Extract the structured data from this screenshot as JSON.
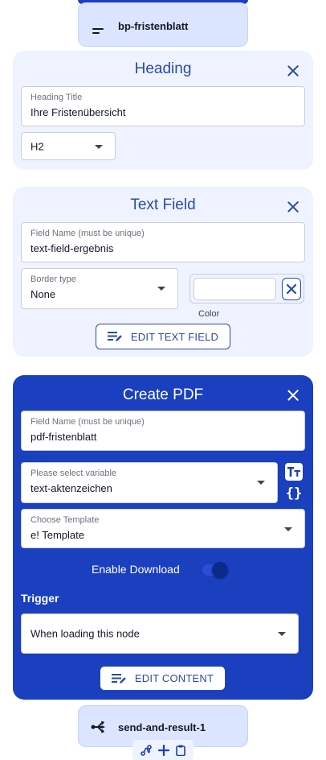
{
  "nodes": {
    "top": {
      "label": "bp-fristenblatt",
      "icon": "menu-lines-icon"
    },
    "bottom": {
      "label": "send-and-result-1",
      "icon": "fork-arrow-icon"
    }
  },
  "heading_card": {
    "title": "Heading",
    "title_field": {
      "label": "Heading Title",
      "value": "Ihre Fristenübersicht"
    },
    "level_select": {
      "value": "H2"
    }
  },
  "text_field_card": {
    "title": "Text Field",
    "name_field": {
      "label": "Field Name (must be unique)",
      "value": "text-field-ergebnis"
    },
    "border_select": {
      "label": "Border type",
      "value": "None"
    },
    "color": {
      "label": "Color",
      "value": ""
    },
    "edit_button": "EDIT TEXT FIELD"
  },
  "pdf_card": {
    "title": "Create PDF",
    "name_field": {
      "label": "Field Name (must be unique)",
      "value": "pdf-fristenblatt"
    },
    "variable_select": {
      "label": "Please select variable",
      "value": "text-aktenzeichen"
    },
    "template_select": {
      "label": "Choose Template",
      "value": "e! Template"
    },
    "download_toggle": {
      "label": "Enable Download",
      "enabled": true
    },
    "trigger": {
      "label": "Trigger",
      "value": "When loading this node"
    },
    "edit_button": "EDIT CONTENT"
  },
  "toolbar": {
    "icons": [
      "route-icon",
      "plus-icon",
      "clipboard-icon"
    ]
  },
  "colors": {
    "accent": "#1a3fbf",
    "card_bg": "#eef3ff",
    "node_bg": "#dbe5ff"
  }
}
